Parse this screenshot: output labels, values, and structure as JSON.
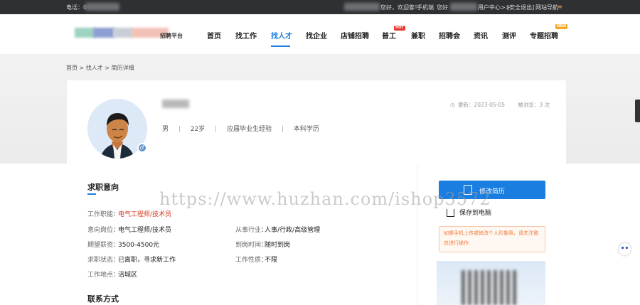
{
  "topbar": {
    "phone_label": "电话：0",
    "welcome": "您好，欢迎您！",
    "mobile_label": "手机端",
    "greeting": "您好",
    "user_center": "用户中心>>",
    "logout": "[安全退出]",
    "site_nav": "网站导航"
  },
  "logo": {
    "subtitle": "招聘平台"
  },
  "nav": {
    "items": [
      "首页",
      "找工作",
      "找人才",
      "找企业",
      "店铺招聘",
      "普工",
      "兼职",
      "招聘会",
      "资讯",
      "测评",
      "专题招聘"
    ],
    "hot_badge": "HOT",
    "new_badge": "NEW",
    "colors": {
      "active": "#1a7de0",
      "hot": "#e8352b",
      "new": "#f5a623"
    }
  },
  "breadcrumb": [
    "首页",
    ">",
    "找人才",
    ">",
    "简历详细"
  ],
  "profile": {
    "gender": "男",
    "age": "22岁",
    "experience": "应届毕业生经验",
    "education": "本科学历",
    "sep": "|",
    "updated": "更新：2023-05-05",
    "views": "被浏览：3 次"
  },
  "job_intent": {
    "title": "求职意向",
    "fields": {
      "job_function_label": "工作职能：",
      "job_function_value": "电气工程师/技术员",
      "position_label": "意向岗位：",
      "position_value": "电气工程师/技术员",
      "industry_label": "从事行业：",
      "industry_value": "人事/行政/高级管理",
      "salary_label": "期望薪资：",
      "salary_value": "3500-4500元",
      "arrival_label": "到岗时间：",
      "arrival_value": "随时到岗",
      "status_label": "求职状态：",
      "status_value": "已离职，寻求新工作",
      "nature_label": "工作性质：",
      "nature_value": "不限",
      "location_label": "工作地点：",
      "location_value": "涪城区"
    }
  },
  "contact": {
    "title": "联系方式"
  },
  "actions": {
    "edit": "修改简历",
    "save": "保存到电脑",
    "notice": "如需手机上传或修改个人形象照，请关注微信进行操作"
  },
  "watermark": "https://www.huzhan.com/ishop3572"
}
